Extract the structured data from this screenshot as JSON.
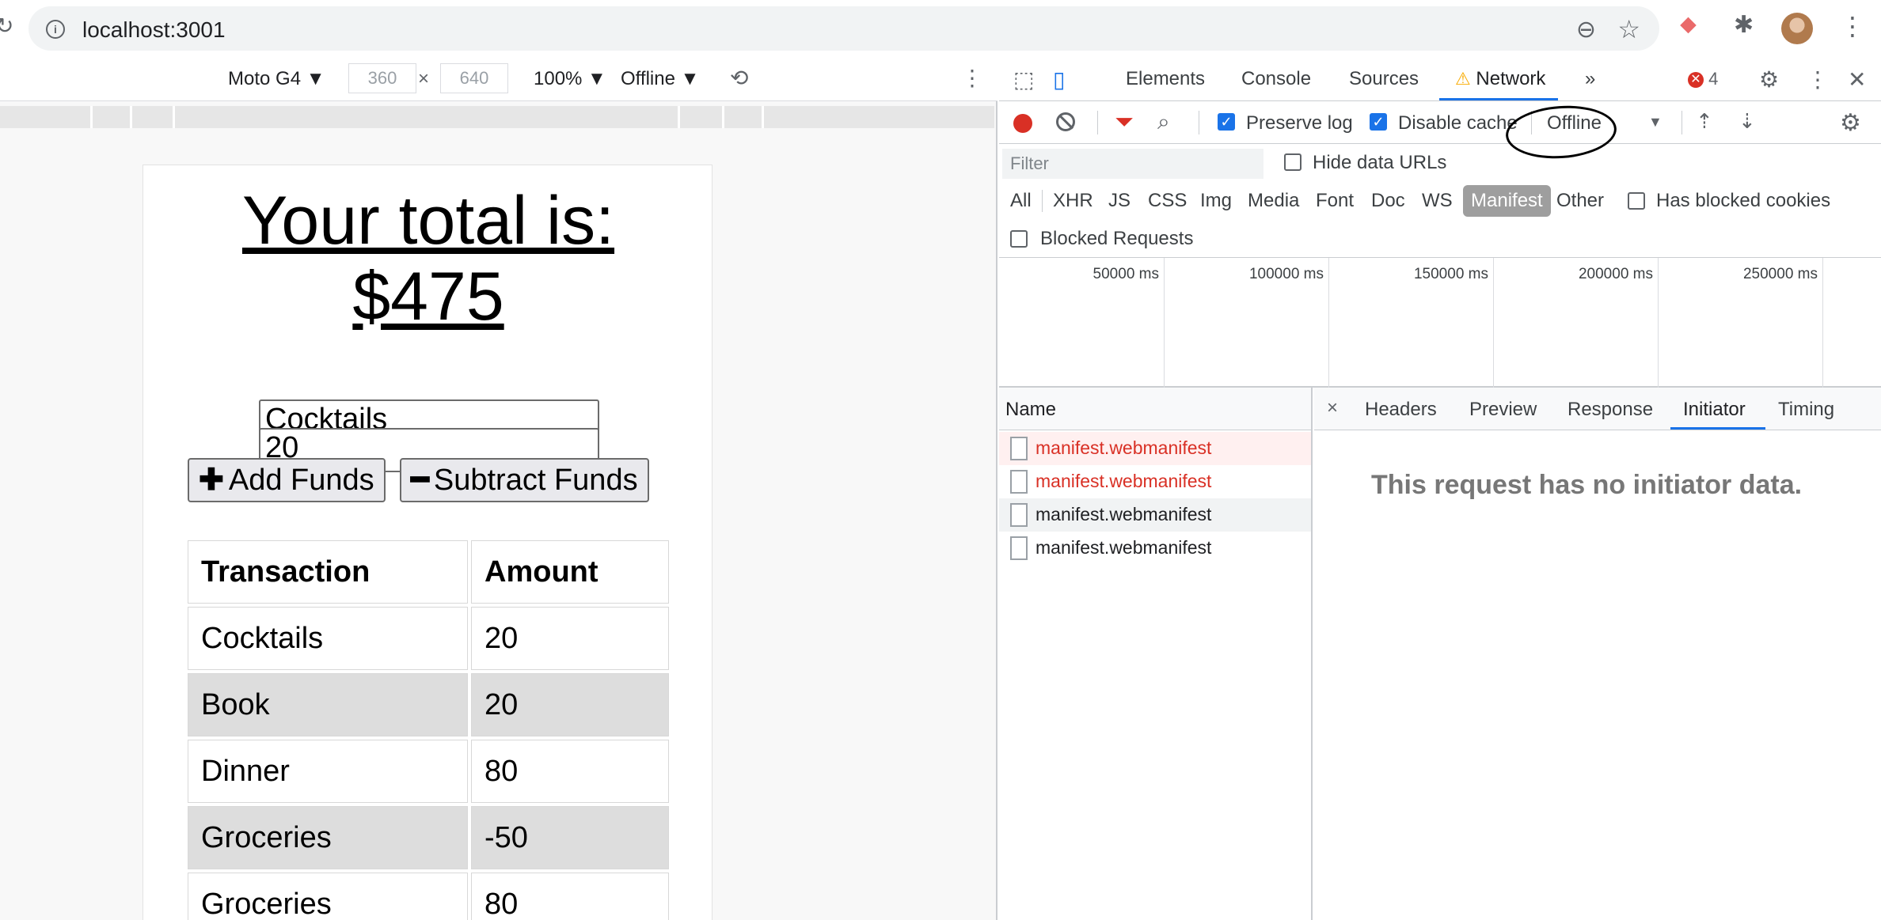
{
  "browser": {
    "url": "localhost:3001",
    "info_icon_text": "i",
    "zoom_icon": "⊖",
    "star_icon": "☆",
    "reload_icon": "↻",
    "extension1_icon": "⬥",
    "extension2_icon": "✱",
    "menu_icon": "⋮"
  },
  "device_toolbar": {
    "device": "Moto G4 ▼",
    "width": "360",
    "height": "640",
    "times": "×",
    "zoom": "100% ▼",
    "throttle": "Offline ▼",
    "rotate_icon": "⟲",
    "menu_icon": "⋮"
  },
  "app": {
    "total_line1": "Your total is:",
    "total_line2": "$475",
    "name_value": "Cocktails",
    "amount_value": "20",
    "add_glyph": "✚",
    "add_label": "Add Funds",
    "subtract_glyph": "━",
    "subtract_label": "Subtract Funds",
    "table_headers": [
      "Transaction",
      "Amount"
    ],
    "rows": [
      {
        "name": "Cocktails",
        "amount": "20"
      },
      {
        "name": "Book",
        "amount": "20"
      },
      {
        "name": "Dinner",
        "amount": "80"
      },
      {
        "name": "Groceries",
        "amount": "-50"
      },
      {
        "name": "Groceries",
        "amount": "80"
      }
    ]
  },
  "devtools": {
    "tabs": [
      "Elements",
      "Console",
      "Sources",
      "Network"
    ],
    "more": "»",
    "warn_glyph": "⚠",
    "error_count": "4",
    "error_glyph": "✕",
    "inspect_icon": "⬚",
    "device_icon": "▯",
    "settings_icon": "⚙",
    "menu_icon": "⋮",
    "close_icon": "✕",
    "toolbar": {
      "preserve_log": "Preserve log",
      "disable_cache": "Disable cache",
      "throttle": "Offline",
      "caret": "▼",
      "funnel_icon": "⏷",
      "search_icon": "⌕",
      "upload_icon": "⇡",
      "download_icon": "⇣",
      "check": "✓"
    },
    "filter_placeholder": "Filter",
    "hide_data_urls": "Hide data URLs",
    "types": [
      "All",
      "XHR",
      "JS",
      "CSS",
      "Img",
      "Media",
      "Font",
      "Doc",
      "WS",
      "Manifest",
      "Other"
    ],
    "has_blocked_cookies": "Has blocked cookies",
    "blocked_requests": "Blocked Requests",
    "timeline": [
      "50000 ms",
      "100000 ms",
      "150000 ms",
      "200000 ms",
      "250000 ms"
    ],
    "name_header": "Name",
    "requests": [
      "manifest.webmanifest",
      "manifest.webmanifest",
      "manifest.webmanifest",
      "manifest.webmanifest"
    ],
    "detail_close": "×",
    "detail_tabs": [
      "Headers",
      "Preview",
      "Response",
      "Initiator",
      "Timing"
    ],
    "no_initiator": "This request has no initiator data."
  },
  "colors": {
    "accent": "#1a73e8",
    "error_red": "#d93025",
    "alt_row": "#dddddd"
  }
}
